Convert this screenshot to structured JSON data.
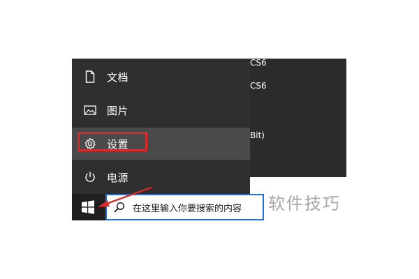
{
  "start_menu": {
    "items": [
      {
        "label": "文档",
        "icon": "document-icon"
      },
      {
        "label": "图片",
        "icon": "picture-icon"
      },
      {
        "label": "设置",
        "icon": "gear-icon"
      },
      {
        "label": "电源",
        "icon": "power-icon"
      }
    ]
  },
  "app_list": {
    "items": [
      "CS6",
      "CS6",
      "Bit)"
    ]
  },
  "taskbar": {
    "start_icon": "windows-logo-icon",
    "search": {
      "placeholder": "在这里输入你要搜索的内容",
      "icon": "search-icon"
    }
  },
  "watermark": {
    "text": "软件技巧"
  },
  "colors": {
    "menu_bg": "#2f2f2f",
    "menu_highlight": "#4a4a4a",
    "annotation_red": "#d92b2b",
    "search_border": "#1f6fd1"
  }
}
